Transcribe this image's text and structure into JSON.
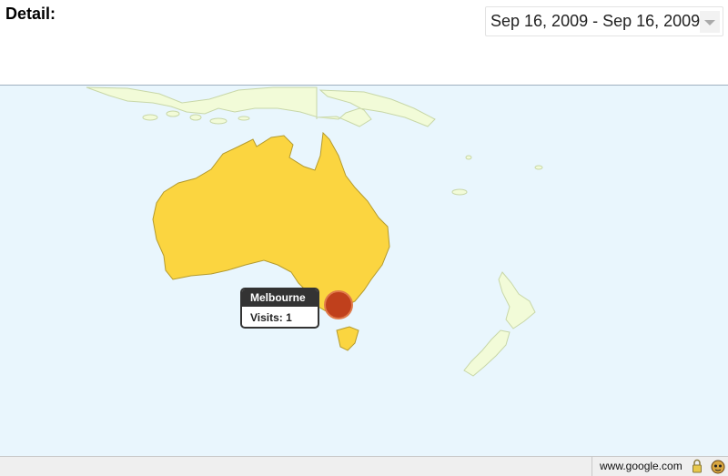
{
  "header": {
    "detail_label": "Detail:",
    "date_range": "Sep 16, 2009 - Sep 16, 2009"
  },
  "map": {
    "region": "Australia",
    "colors": {
      "ocean": "#e9f6fd",
      "highlighted_country": "#fbd540",
      "other_land": "#f2fbd8",
      "marker": "#c0401c"
    },
    "marker": {
      "city": "Melbourne",
      "visits_text": "Visits: 1",
      "visits": 1
    }
  },
  "status_bar": {
    "host": "www.google.com",
    "icons": [
      "lock-icon",
      "addon-icon"
    ]
  }
}
